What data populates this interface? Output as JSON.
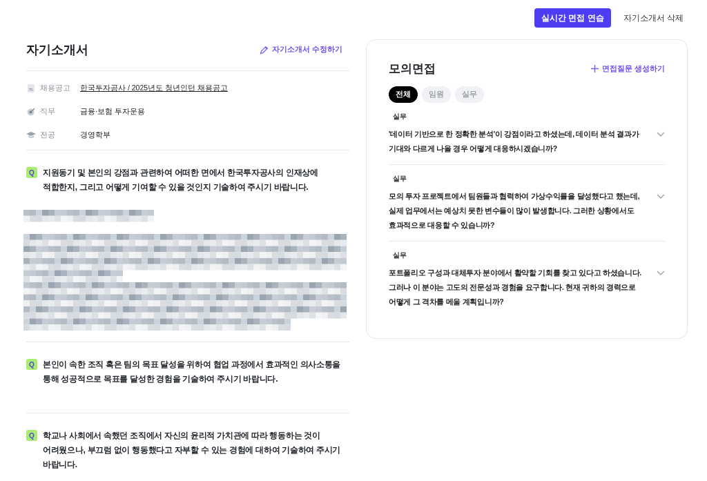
{
  "top_actions": [
    {
      "label": "실시간 면접 연습",
      "kind": "primary"
    },
    {
      "label": "자기소개서 삭제",
      "kind": "text"
    }
  ],
  "essay": {
    "title": "자기소개서",
    "edit_link": "자기소개서 수정하기",
    "info": [
      {
        "kind": "posting",
        "label": "채용공고",
        "value": "한국투자공사 / 2025년도 청년인턴 채용공고",
        "link": true
      },
      {
        "kind": "job",
        "label": "직무",
        "value": "금융·보험 투자운용",
        "link": false
      },
      {
        "kind": "major",
        "label": "전공",
        "value": "경영학부",
        "link": false
      }
    ],
    "questions": [
      {
        "badge": "Q",
        "text": "지원동기 및 본인의 강점과 관련하여 어떠한 면에서 한국투자공사의 인재상에 적합한지, 그리고 어떻게 기여할 수 있을 것인지 기술하여 주시기 바랍니다.",
        "answer_blurred": true
      },
      {
        "badge": "Q",
        "text": "본인이 속한 조직 혹은 팀의 목표 달성을 위하여 협업 과정에서 효과적인 의사소통을 통해 성공적으로 목표를 달성한 경험을 기술하여 주시기 바랍니다.",
        "answer_blurred": false
      },
      {
        "badge": "Q",
        "text": "학교나 사회에서 속했던 조직에서 자신의 윤리적 가치관에 따라 행동하는 것이 어려웠으나, 부끄럼 없이 행동했다고 자부할 수 있는 경험에 대하여 기술하여 주시기 바랍니다.",
        "answer_blurred": false
      }
    ]
  },
  "interview": {
    "title": "모의면접",
    "generate_link": "면접질문 생성하기",
    "filters": [
      {
        "label": "전체",
        "selected": true
      },
      {
        "label": "임원",
        "selected": false
      },
      {
        "label": "실무",
        "selected": false
      }
    ],
    "questions": [
      {
        "category": "실무",
        "text": "'데이터 기반으로 한 정확한 분석'이 강점이라고 하셨는데, 데이터 분석 결과가 기대와 다르게 나올 경우 어떻게 대응하시겠습니까?",
        "expanded": false
      },
      {
        "category": "실무",
        "text": "모의 투자 프로젝트에서 팀원들과 협력하여 가상수익률을 달성했다고 했는데, 실제 업무에서는 예상치 못한 변수들이 많이 발생합니다. 그러한 상황에서도 효과적으로 대응할 수 있습니까?",
        "expanded": false
      },
      {
        "category": "실무",
        "text": "포트폴리오 구성과 대체투자 분야에서 활약할 기회를 찾고 있다고 하셨습니다. 그러나 이 분야는 고도의 전문성과 경험을 요구합니다. 현재 귀하의 경력으로 어떻게 그 격차를 메울 계획입니까?",
        "expanded": false
      }
    ]
  }
}
